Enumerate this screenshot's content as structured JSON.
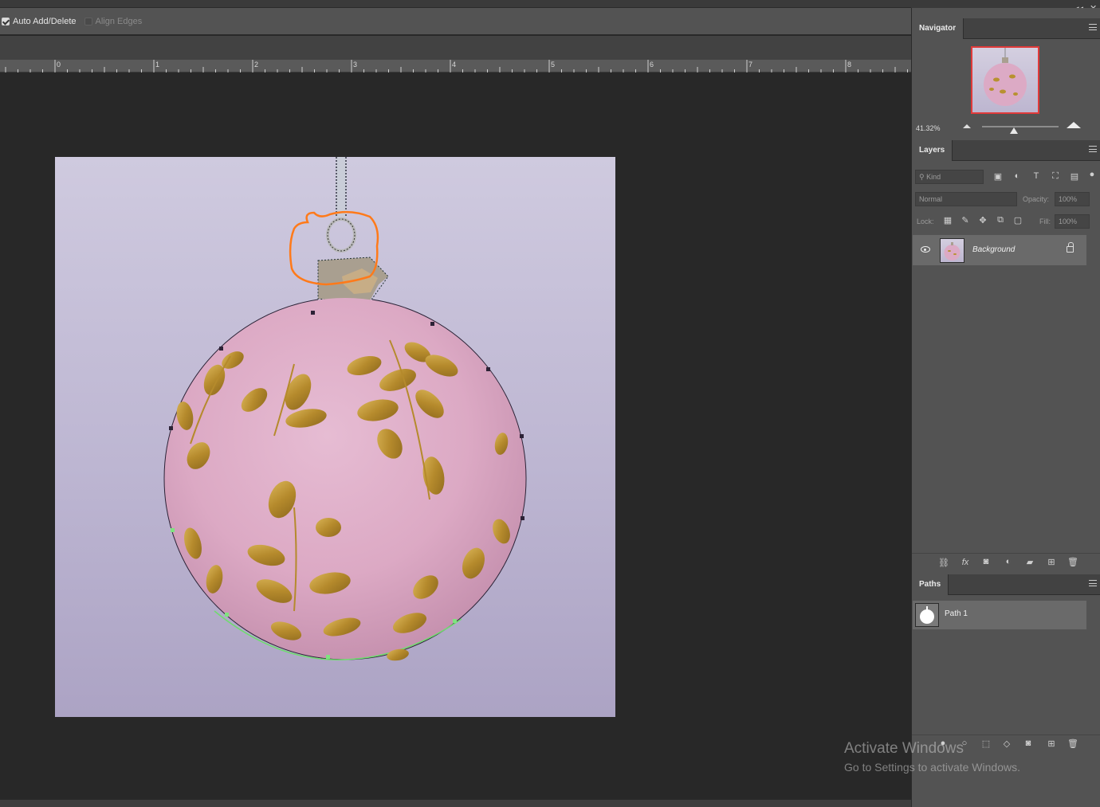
{
  "options": {
    "auto_add_delete": "Auto Add/Delete",
    "align_edges": "Align Edges"
  },
  "ruler": {
    "labels": [
      "0",
      "1",
      "2",
      "3",
      "4",
      "5",
      "6",
      "7",
      "8"
    ]
  },
  "navigator": {
    "tab": "Navigator",
    "zoom": "41.32%"
  },
  "layers": {
    "tab": "Layers",
    "filter_placeholder": "Kind",
    "blend_mode": "Normal",
    "opacity_label": "Opacity:",
    "opacity_value": "100%",
    "lock_label": "Lock:",
    "fill_label": "Fill:",
    "fill_value": "100%",
    "items": [
      {
        "name": "Background"
      }
    ]
  },
  "paths": {
    "tab": "Paths",
    "items": [
      {
        "name": "Path 1"
      }
    ]
  },
  "watermark": {
    "line1": "Activate Windows",
    "line2": "Go to Settings to activate Windows."
  },
  "colors": {
    "accent_red": "#e03a3a",
    "annotation_orange": "#ff7a1a",
    "path_green": "#6fdc6f"
  }
}
